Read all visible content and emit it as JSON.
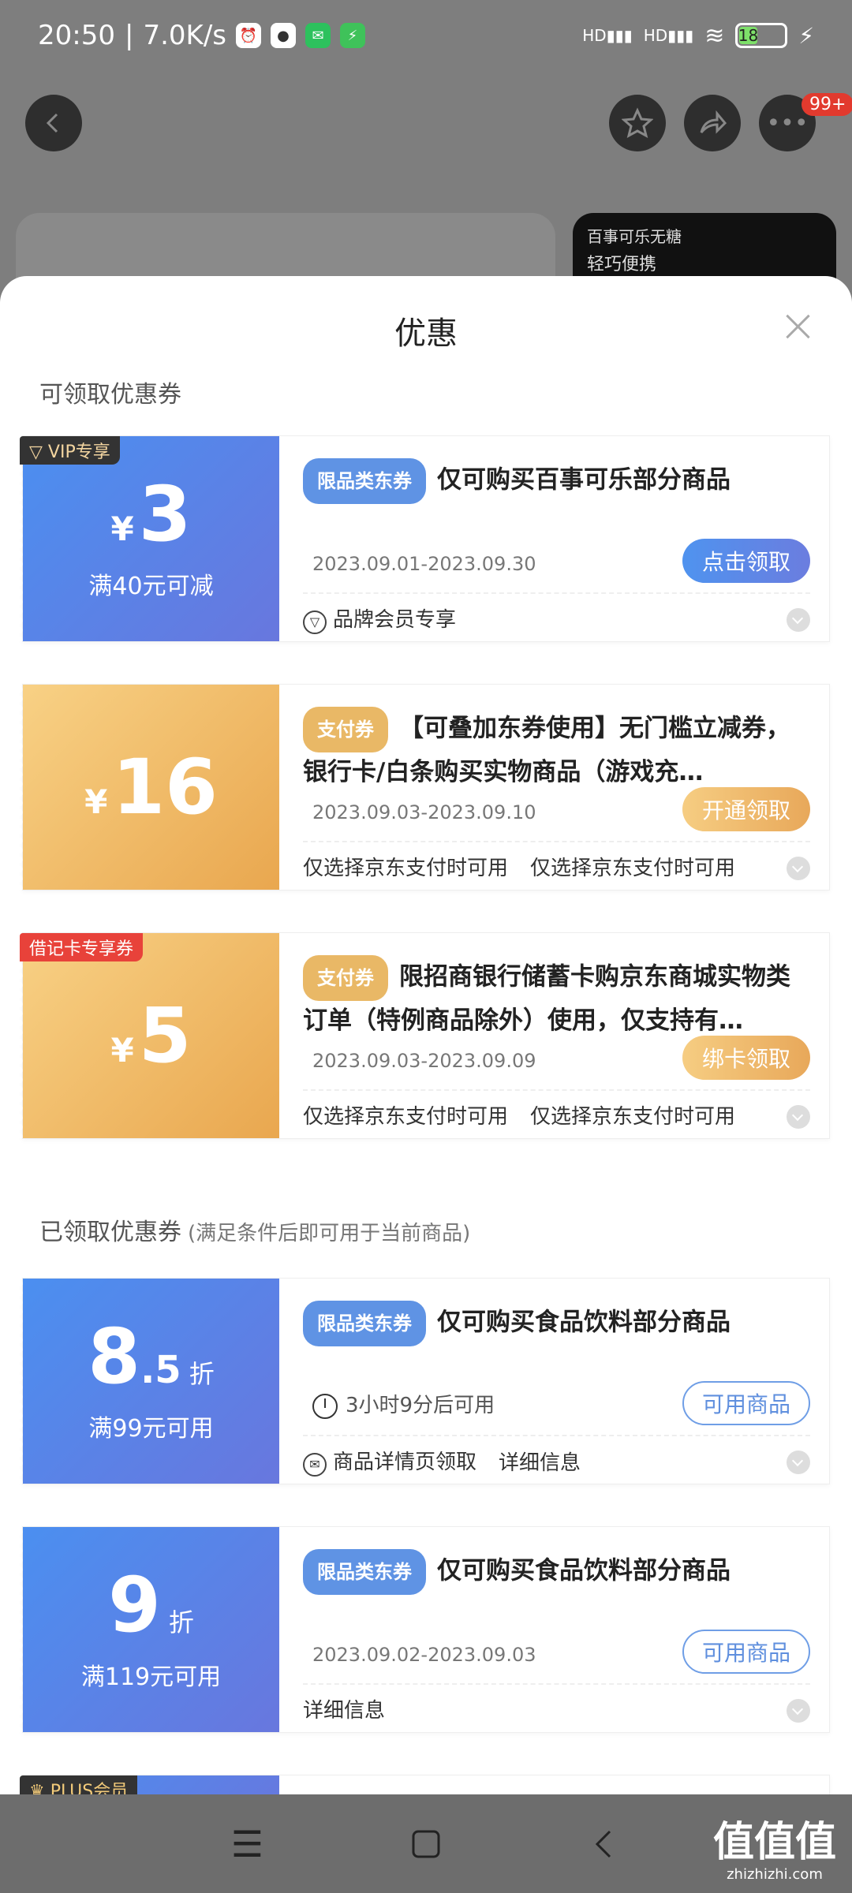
{
  "status": {
    "time": "20:50",
    "speed": "7.0K/s",
    "network1": "HD",
    "network2": "HD",
    "battery": "18"
  },
  "topbar": {
    "badge": "99+"
  },
  "bg_ad": {
    "brand": "百事可乐无糖",
    "slogan": "轻巧便携"
  },
  "sheet": {
    "title": "优惠",
    "section1_title": "可领取优惠券",
    "section2_title": "已领取优惠券",
    "section2_sub": "(满足条件后即可用于当前商品)"
  },
  "coupons_available": [
    {
      "tag": "VIP专享",
      "yen": "¥",
      "amount": "3",
      "condition": "满40元可减",
      "type": "限品类东券",
      "desc": "仅可购买百事可乐部分商品",
      "date": "2023.09.01-2023.09.30",
      "action": "点击领取",
      "foot1": "品牌会员专享",
      "foot2": ""
    },
    {
      "tag": "",
      "yen": "¥",
      "amount": "16",
      "condition": "",
      "type": "支付券",
      "desc": "【可叠加东券使用】无门槛立减券，银行卡/白条购买实物商品（游戏充…",
      "date": "2023.09.03-2023.09.10",
      "action": "开通领取",
      "foot1": "仅选择京东支付时可用",
      "foot2": "仅选择京东支付时可用"
    },
    {
      "tag": "借记卡专享券",
      "yen": "¥",
      "amount": "5",
      "condition": "",
      "type": "支付券",
      "desc": "限招商银行储蓄卡购京东商城实物类订单（特例商品除外）使用，仅支持有…",
      "date": "2023.09.03-2023.09.09",
      "action": "绑卡领取",
      "foot1": "仅选择京东支付时可用",
      "foot2": "仅选择京东支付时可用"
    }
  ],
  "coupons_received": [
    {
      "amount_int": "8",
      "amount_dec": ".5",
      "unit": "折",
      "condition": "满99元可用",
      "type": "限品类东券",
      "desc": "仅可购买食品饮料部分商品",
      "date": "3小时9分后可用",
      "action": "可用商品",
      "foot1": "商品详情页领取",
      "foot2": "详细信息"
    },
    {
      "amount_int": "9",
      "amount_dec": "",
      "unit": "折",
      "condition": "满119元可用",
      "type": "限品类东券",
      "desc": "仅可购买食品饮料部分商品",
      "date": "2023.09.02-2023.09.03",
      "action": "可用商品",
      "foot1": "详细信息",
      "foot2": ""
    }
  ],
  "partial_tag": "PLUS会员",
  "watermark": {
    "text": "值值值",
    "url": "zhizhizhi.com"
  }
}
